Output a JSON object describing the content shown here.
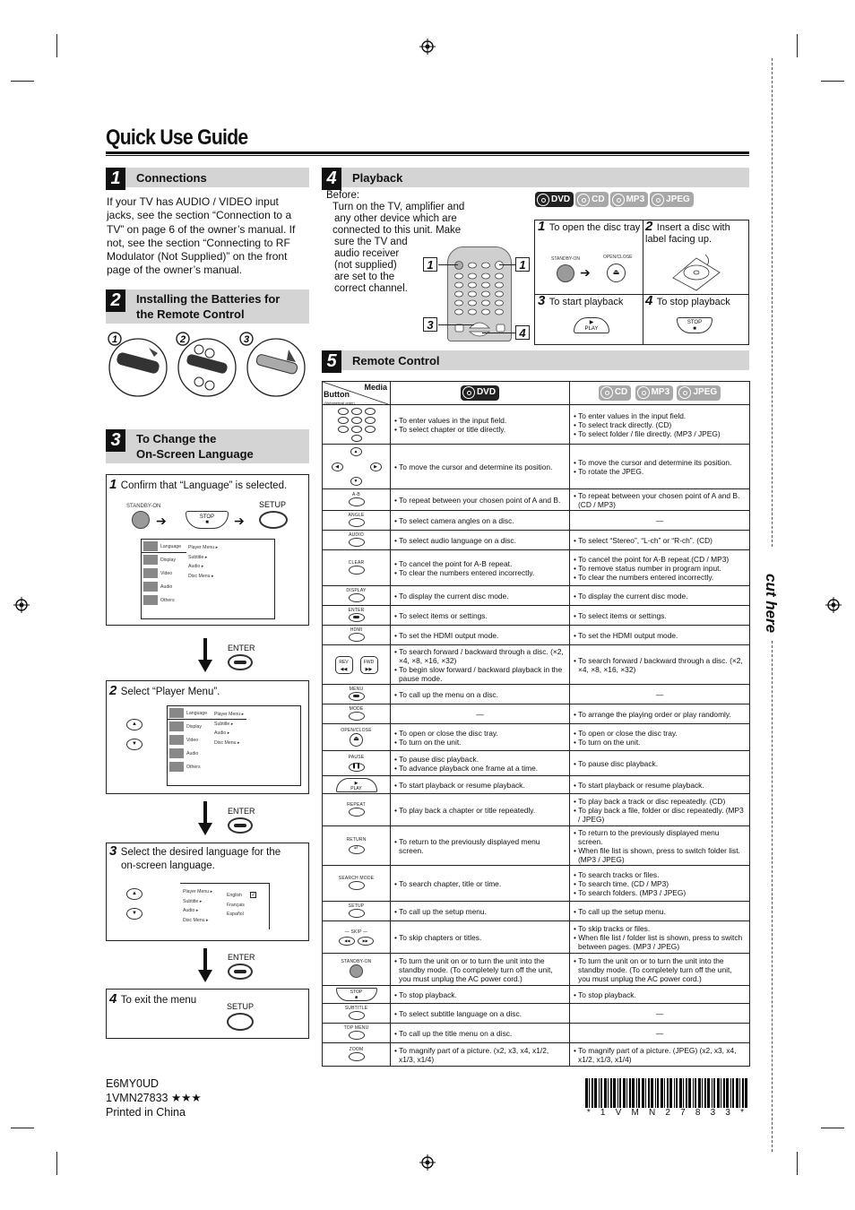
{
  "title": "Quick Use Guide",
  "cut_label": "cut here",
  "sections": {
    "connections": {
      "number": "1",
      "heading": "Connections",
      "body": "If your TV has AUDIO / VIDEO input jacks, see the section “Connection to a TV” on page 6 of the owner’s manual. If not, see the section “Connecting to RF Modulator (Not Supplied)” on the front page of the owner’s manual."
    },
    "batteries": {
      "number": "2",
      "heading_line1": "Installing the Batteries for",
      "heading_line2": "the Remote Control",
      "steps": [
        "1",
        "2",
        "3"
      ]
    },
    "language": {
      "number": "3",
      "heading_line1": "To Change the",
      "heading_line2": "On-Screen Language",
      "step1": {
        "num": "1",
        "text": "Confirm that “Language” is selected.",
        "standby_label": "STANDBY-ON",
        "stop_label": "STOP",
        "setup_label": "SETUP"
      },
      "enter_label": "ENTER",
      "step2": {
        "num": "2",
        "text": "Select “Player Menu”."
      },
      "step3": {
        "num": "3",
        "text_line1": "Select the desired language for the",
        "text_line2": "on-screen language."
      },
      "step4": {
        "num": "4",
        "text": "To exit the menu",
        "setup_label": "SETUP"
      },
      "menu_left": [
        "Language",
        "Display",
        "Video",
        "Audio",
        "Others"
      ],
      "menu_right": [
        "Player Menu",
        "Subtitle",
        "Audio",
        "Disc Menu"
      ],
      "languages": [
        "English",
        "Français",
        "Español"
      ]
    },
    "playback": {
      "number": "4",
      "heading": "Playback",
      "before_label": "Before:",
      "before_lines": [
        "Turn on the TV, amplifier and",
        "any other device which are",
        "connected to this unit. Make",
        "sure the TV and",
        "audio receiver",
        "(not supplied)",
        "are set to the",
        "correct channel."
      ],
      "media": [
        "DVD",
        "CD",
        "MP3",
        "JPEG"
      ],
      "callouts": [
        "1",
        "1",
        "3",
        "4"
      ],
      "steps": [
        {
          "num": "1",
          "text": "To open the disc tray",
          "btn1": "STANDBY-ON",
          "btn2": "OPEN/CLOSE"
        },
        {
          "num": "2",
          "text": "Insert a disc with label facing up."
        },
        {
          "num": "3",
          "text": "To start playback",
          "btn": "PLAY"
        },
        {
          "num": "4",
          "text": "To stop playback",
          "btn": "STOP"
        }
      ]
    },
    "remote": {
      "number": "5",
      "heading": "Remote Control",
      "header": {
        "media": "Media",
        "button": "Button",
        "button_sub": "(Alphabetical order)",
        "col_dvd": "DVD",
        "col_other": [
          "CD",
          "MP3",
          "JPEG"
        ]
      },
      "rows": [
        {
          "button": "0–9 number keys",
          "dvd": [
            "To enter values in the input field.",
            "To select chapter or title directly."
          ],
          "other": [
            "To enter values in the input field.",
            "To select track directly. (CD)",
            "To select folder / file directly. (MP3 / JPEG)"
          ]
        },
        {
          "button": "Cursor keys",
          "dvd": [
            "To move the cursor and determine its position."
          ],
          "other": [
            "To move the cursor and determine its position.",
            "To rotate the JPEG."
          ]
        },
        {
          "button": "A-B",
          "dvd": [
            "To repeat between your chosen point of A and B."
          ],
          "other": [
            "To repeat between your chosen point of A and B. (CD / MP3)"
          ]
        },
        {
          "button": "ANGLE",
          "dvd": [
            "To select camera angles on a disc."
          ],
          "other": [
            "—"
          ]
        },
        {
          "button": "AUDIO",
          "dvd": [
            "To select audio language on a disc."
          ],
          "other": [
            "To select “Stereo”, “L-ch” or “R-ch”. (CD)"
          ]
        },
        {
          "button": "CLEAR",
          "dvd": [
            "To cancel the point for A-B repeat.",
            "To clear the numbers entered incorrectly."
          ],
          "other": [
            "To cancel the point for A-B repeat.(CD / MP3)",
            "To remove status number in program input.",
            "To clear the numbers entered incorrectly."
          ]
        },
        {
          "button": "DISPLAY",
          "dvd": [
            "To display the current disc mode."
          ],
          "other": [
            "To display the current disc mode."
          ]
        },
        {
          "button": "ENTER",
          "dvd": [
            "To select items or settings."
          ],
          "other": [
            "To select items or settings."
          ]
        },
        {
          "button": "HDMI",
          "dvd": [
            "To set the HDMI output mode."
          ],
          "other": [
            "To set the HDMI output mode."
          ]
        },
        {
          "button": "REV / FWD",
          "dvd": [
            "To search forward / backward through a disc. (×2, ×4, ×8, ×16, ×32)",
            "To begin slow forward / backward playback in the pause mode."
          ],
          "other": [
            "To search forward / backward through a disc. (×2, ×4, ×8, ×16, ×32)"
          ]
        },
        {
          "button": "MENU",
          "dvd": [
            "To call up the menu on a disc."
          ],
          "other": [
            "—"
          ]
        },
        {
          "button": "MODE",
          "dvd": [
            "—"
          ],
          "other": [
            "To arrange the playing order or play randomly."
          ]
        },
        {
          "button": "OPEN/CLOSE",
          "dvd": [
            "To open or close the disc tray.",
            "To turn on the unit."
          ],
          "other": [
            "To open or close the disc tray.",
            "To turn on the unit."
          ]
        },
        {
          "button": "PAUSE",
          "dvd": [
            "To pause disc playback.",
            "To advance playback one frame at a time."
          ],
          "other": [
            "To pause disc playback."
          ]
        },
        {
          "button": "PLAY",
          "dvd": [
            "To start playback or resume playback."
          ],
          "other": [
            "To start playback or resume playback."
          ]
        },
        {
          "button": "REPEAT",
          "dvd": [
            "To play back a chapter or title repeatedly."
          ],
          "other": [
            "To play back a track or disc repeatedly. (CD)",
            "To play back a file, folder or disc repeatedly. (MP3 / JPEG)"
          ]
        },
        {
          "button": "RETURN",
          "dvd": [
            "To return to the previously displayed menu screen."
          ],
          "other": [
            "To return to the previously displayed menu screen.",
            "When file list is shown, press to switch folder list. (MP3 / JPEG)"
          ]
        },
        {
          "button": "SEARCH MODE",
          "dvd": [
            "To search chapter, title or time."
          ],
          "other": [
            "To search tracks or files.",
            "To search time. (CD / MP3)",
            "To search folders. (MP3 / JPEG)"
          ]
        },
        {
          "button": "SETUP",
          "dvd": [
            "To call up the setup menu."
          ],
          "other": [
            "To call up the setup menu."
          ]
        },
        {
          "button": "SKIP",
          "dvd": [
            "To skip chapters or titles."
          ],
          "other": [
            "To skip tracks or files.",
            "When file list / folder list is shown, press to switch between pages. (MP3 / JPEG)"
          ]
        },
        {
          "button": "STANDBY-ON",
          "dvd": [
            "To turn the unit on or to turn the unit into the standby mode. (To completely turn off the unit, you must unplug the AC power cord.)"
          ],
          "other": [
            "To turn the unit on or to turn the unit into the standby mode. (To completely turn off the unit, you must unplug the AC power cord.)"
          ]
        },
        {
          "button": "STOP",
          "dvd": [
            "To stop playback."
          ],
          "other": [
            "To stop playback."
          ]
        },
        {
          "button": "SUBTITLE",
          "dvd": [
            "To select subtitle language on a disc."
          ],
          "other": [
            "—"
          ]
        },
        {
          "button": "TOP MENU",
          "dvd": [
            "To call up the title menu on a disc."
          ],
          "other": [
            "—"
          ]
        },
        {
          "button": "ZOOM",
          "dvd": [
            "To magnify part of a picture. (x2, x3, x4, x1/2, x1/3, x1/4)"
          ],
          "other": [
            "To magnify part of a picture. (JPEG) (x2, x3, x4, x1/2, x1/3, x1/4)"
          ]
        }
      ]
    }
  },
  "footer": {
    "model": "E6MY0UD",
    "part": "1VMN27833 ★★★",
    "printed": "Printed in China",
    "barcode_text": "* 1 V M N 2 7 8 3 3 *"
  }
}
